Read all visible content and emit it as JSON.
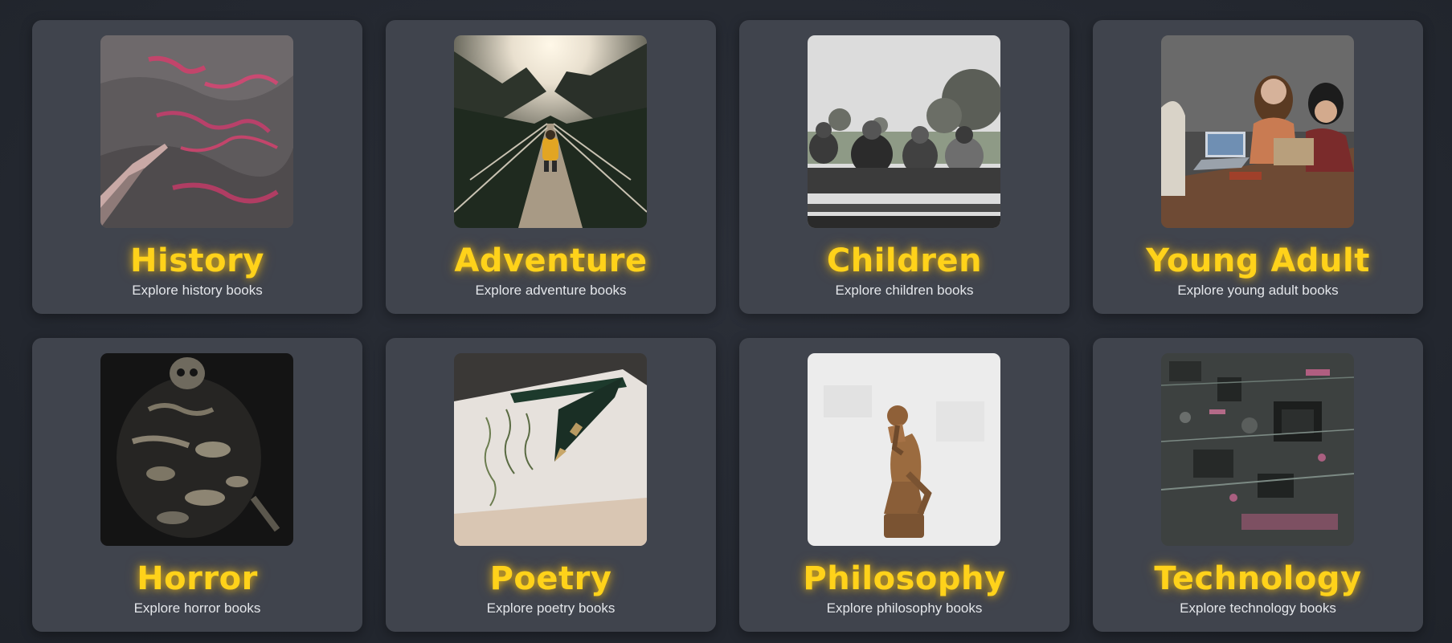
{
  "categories": [
    {
      "title": "History",
      "subtitle": "Explore history books",
      "image": "red-rock-petroglyph-photo"
    },
    {
      "title": "Adventure",
      "subtitle": "Explore adventure books",
      "image": "hiker-suspension-bridge-photo"
    },
    {
      "title": "Children",
      "subtitle": "Explore children books",
      "image": "children-on-bench-photo"
    },
    {
      "title": "Young Adult",
      "subtitle": "Explore young adult books",
      "image": "students-with-laptops-photo"
    },
    {
      "title": "Horror",
      "subtitle": "Explore horror books",
      "image": "skeleton-remains-photo"
    },
    {
      "title": "Poetry",
      "subtitle": "Explore poetry books",
      "image": "fountain-pen-on-paper-photo"
    },
    {
      "title": "Philosophy",
      "subtitle": "Explore philosophy books",
      "image": "thinker-statue-photo"
    },
    {
      "title": "Technology",
      "subtitle": "Explore technology books",
      "image": "circuit-board-photo"
    }
  ],
  "colors": {
    "background": "#262a33",
    "card": "#40444d",
    "title": "#ffd21a",
    "subtitle": "#e4e6ea"
  }
}
